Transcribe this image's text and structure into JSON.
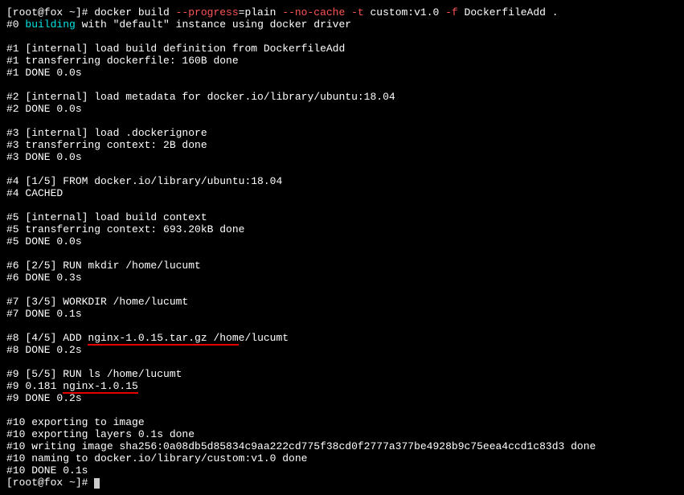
{
  "prompt": {
    "userhost": "[root@fox ~]# ",
    "cmd": "docker build ",
    "opt1": "--progress",
    "eq": "=plain ",
    "opt2": "--no-cache",
    "sp1": " ",
    "opt3": "-t",
    "arg1": " custom:v1.0 ",
    "opt4": "-f",
    "arg2": " DockerfileAdd ."
  },
  "lines": {
    "l0a": "#0 ",
    "l0b": "building",
    "l0c": " with \"default\" instance using docker driver",
    "l1": "#1 [internal] load build definition from DockerfileAdd",
    "l2": "#1 transferring dockerfile: 160B done",
    "l3": "#1 DONE 0.0s",
    "l4": "#2 [internal] load metadata for docker.io/library/ubuntu:18.04",
    "l5": "#2 DONE 0.0s",
    "l6": "#3 [internal] load .dockerignore",
    "l7": "#3 transferring context: 2B done",
    "l8": "#3 DONE 0.0s",
    "l9": "#4 [1/5] FROM docker.io/library/ubuntu:18.04",
    "l10": "#4 CACHED",
    "l11": "#5 [internal] load build context",
    "l12": "#5 transferring context: 693.20kB done",
    "l13": "#5 DONE 0.0s",
    "l14": "#6 [2/5] RUN mkdir /home/lucumt",
    "l15": "#6 DONE 0.3s",
    "l16": "#7 [3/5] WORKDIR /home/lucumt",
    "l17": "#7 DONE 0.1s",
    "l18a": "#8 [4/5] ADD ",
    "l18b": "nginx-1.0.15.tar.gz ",
    "l18c": "/hom",
    "l18d": "e/lucumt",
    "l19": "#8 DONE 0.2s",
    "l20": "#9 [5/5] RUN ls /home/lucumt",
    "l21a": "#9 0.181 ",
    "l21b": "nginx-1.0.15",
    "l22": "#9 DONE 0.2s",
    "l23": "#10 exporting to image",
    "l24": "#10 exporting layers 0.1s done",
    "l25": "#10 writing image sha256:0a08db5d85834c9aa222cd775f38cd0f2777a377be4928b9c75eea4ccd1c83d3 done",
    "l26": "#10 naming to docker.io/library/custom:v1.0 done",
    "l27": "#10 DONE 0.1s",
    "endprompt": "[root@fox ~]# "
  }
}
